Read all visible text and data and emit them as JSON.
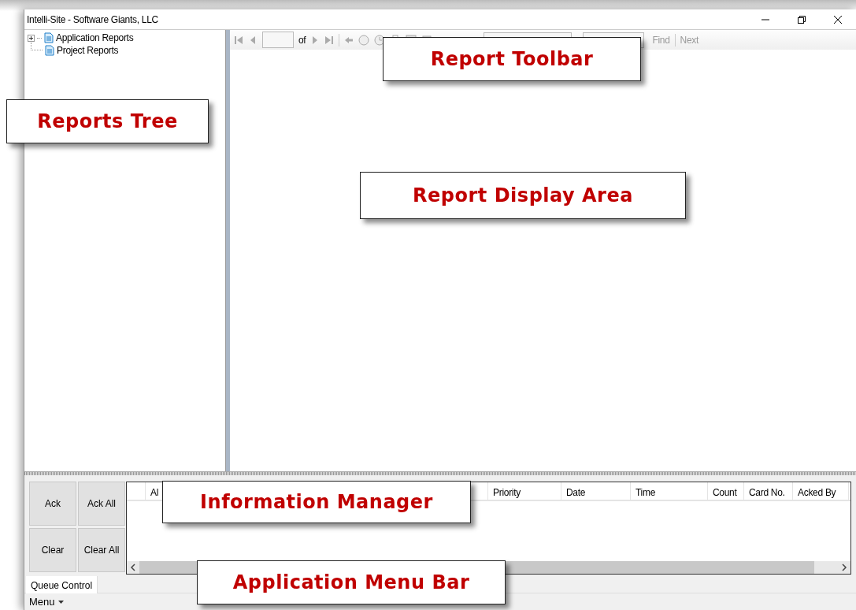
{
  "window": {
    "title": "Intelli-Site - Software Giants, LLC"
  },
  "tree": [
    {
      "kind": "group",
      "label": "Application Reports",
      "expanded": false
    },
    {
      "kind": "report",
      "label": "Project Reports"
    }
  ],
  "toolbar": {
    "of_label": "of",
    "find_label": "Find",
    "next_label": "Next"
  },
  "queue_buttons": [
    "Ack",
    "Ack All",
    "Clear",
    "Clear All"
  ],
  "columns": [
    "Al",
    "Priority",
    "Date",
    "Time",
    "Count",
    "Card No.",
    "Acked By"
  ],
  "tabs": [
    {
      "label": "Queue Control",
      "selected": true
    }
  ],
  "menu": {
    "label": "Menu"
  },
  "callouts": [
    "Report Toolbar",
    "Reports Tree",
    "Report Display Area",
    "Information Manager",
    "Application Menu Bar"
  ]
}
